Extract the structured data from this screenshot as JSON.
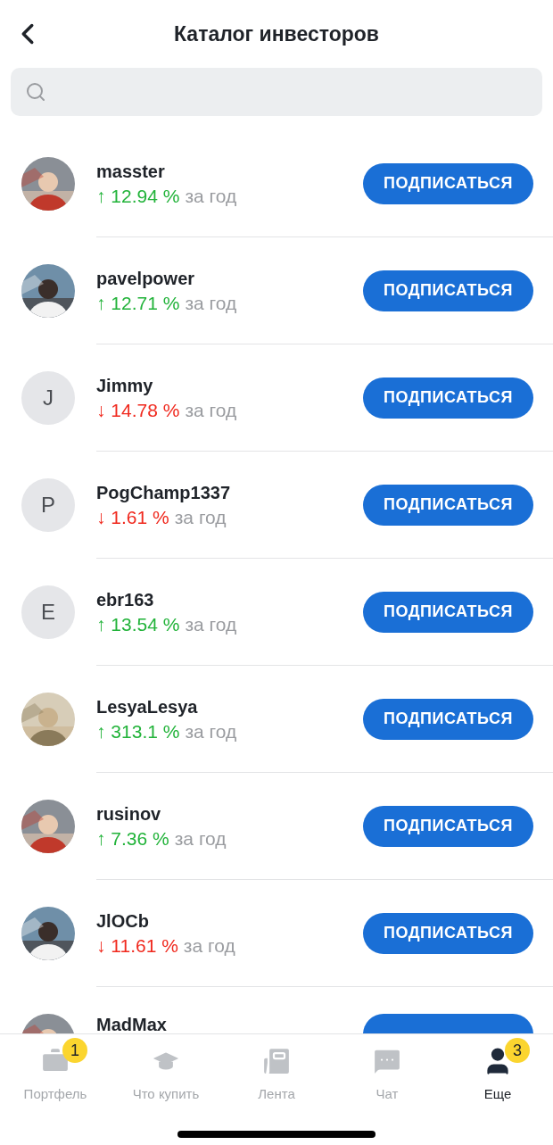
{
  "header": {
    "title": "Каталог инвесторов"
  },
  "investors": [
    {
      "name": "masster",
      "kind": "gain",
      "arrow": "↑",
      "change": "12.94 %",
      "period": "за год",
      "button": "ПОДПИСАТЬСЯ"
    },
    {
      "name": "pavelpower",
      "kind": "gain",
      "arrow": "↑",
      "change": "12.71 %",
      "period": "за год",
      "button": "ПОДПИСАТЬСЯ"
    },
    {
      "name": "Jimmy",
      "avatar": {
        "kind": "letter",
        "letter": "J"
      },
      "kind": "loss",
      "arrow": "↓",
      "change": "14.78 %",
      "period": "за год",
      "button": "ПОДПИСАТЬСЯ"
    },
    {
      "name": "PogChamp1337",
      "avatar": {
        "kind": "letter",
        "letter": "P"
      },
      "kind": "loss",
      "arrow": "↓",
      "change": "1.61 %",
      "period": "за год",
      "button": "ПОДПИСАТЬСЯ"
    },
    {
      "name": "ebr163",
      "avatar": {
        "kind": "letter",
        "letter": "E"
      },
      "kind": "gain",
      "arrow": "↑",
      "change": "13.54 %",
      "period": "за год",
      "button": "ПОДПИСАТЬСЯ"
    },
    {
      "name": "LesyaLesya",
      "kind": "gain",
      "arrow": "↑",
      "change": "313.1 %",
      "period": "за год",
      "button": "ПОДПИСАТЬСЯ"
    },
    {
      "name": "rusinov",
      "kind": "gain",
      "arrow": "↑",
      "change": "7.36 %",
      "period": "за год",
      "button": "ПОДПИСАТЬСЯ"
    },
    {
      "name": "JlOCb",
      "kind": "loss",
      "arrow": "↓",
      "change": "11.61 %",
      "period": "за год",
      "button": "ПОДПИСАТЬСЯ"
    }
  ],
  "partial_investor": {
    "name": "MadMax"
  },
  "tab_bar": [
    {
      "label": "Портфель",
      "badge": "1",
      "selected": false
    },
    {
      "label": "Что купить",
      "selected": false
    },
    {
      "label": "Лента",
      "selected": false
    },
    {
      "label": "Чат",
      "selected": false
    },
    {
      "label": "Еще",
      "badge": "3",
      "selected": true
    }
  ]
}
